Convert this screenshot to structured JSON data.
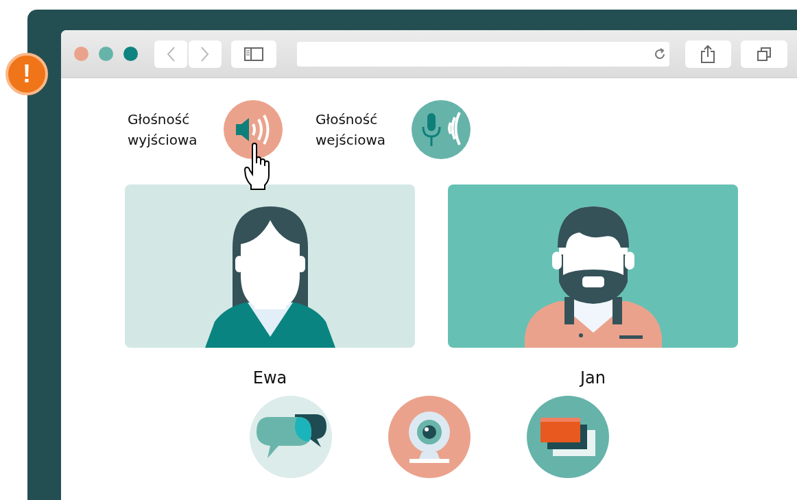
{
  "alert": {
    "symbol": "!"
  },
  "volume_controls": [
    {
      "label": "Głośność wyjściowa",
      "kind": "speaker",
      "hovered": true
    },
    {
      "label": "Głośność wejściowa",
      "kind": "microphone",
      "hovered": false
    }
  ],
  "participants": [
    {
      "name": "Ewa",
      "kind": "woman"
    },
    {
      "name": "Jan",
      "kind": "man"
    }
  ],
  "actions": [
    {
      "kind": "chat"
    },
    {
      "kind": "camera"
    },
    {
      "kind": "screen"
    }
  ]
}
